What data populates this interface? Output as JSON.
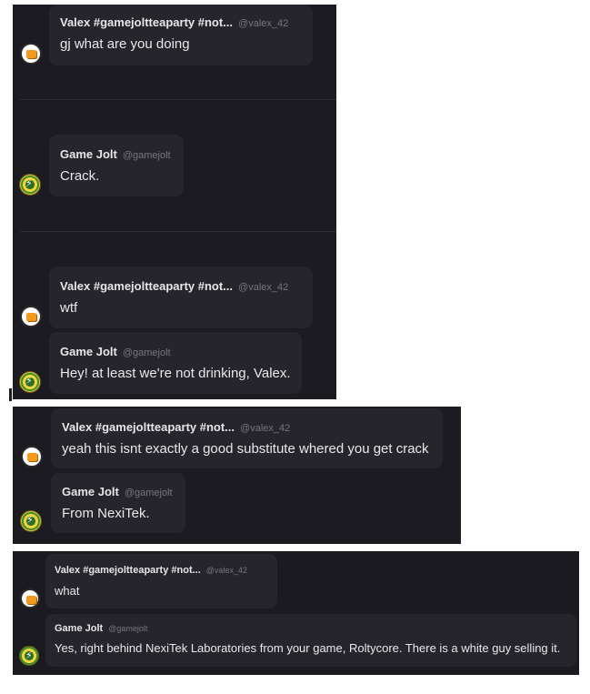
{
  "users": {
    "valex": {
      "name": "Valex #gamejoltteaparty #not...",
      "handle": "@valex_42"
    },
    "gamejolt": {
      "name": "Game Jolt",
      "handle": "@gamejolt"
    }
  },
  "panel1": {
    "m1": "gj what are you doing",
    "m2": "Crack.",
    "m3": "wtf",
    "m4": "Hey! at least we're not drinking, Valex."
  },
  "panel2": {
    "m1": "yeah this isnt exactly a good substitute whered you get crack",
    "m2": "From NexiTek."
  },
  "panel3": {
    "m1": "what",
    "m2": "Yes, right behind NexiTek Laboratories from your game, Roltycore. There is a white guy selling it."
  },
  "colors": {
    "background": "#1c1b21",
    "bubble": "#26252c",
    "text": "#e8e8ec",
    "handle": "#76757c"
  }
}
